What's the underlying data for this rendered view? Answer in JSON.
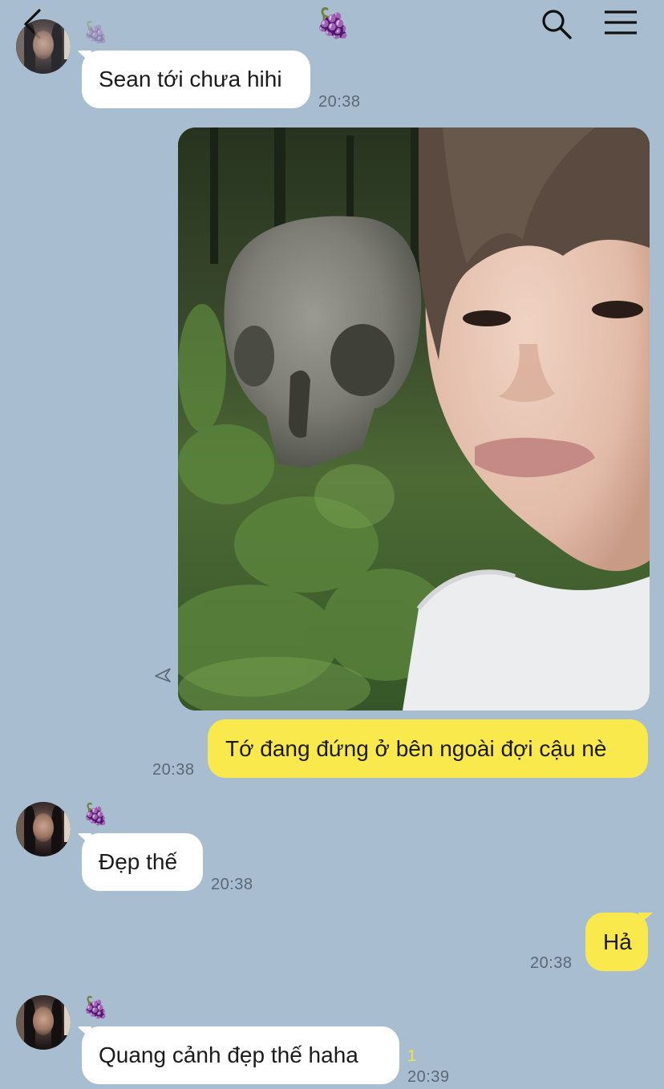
{
  "header": {
    "back_icon": "chevron-left-icon",
    "title_emoji": "🍇",
    "search_icon": "search-icon",
    "menu_icon": "hamburger-menu-icon"
  },
  "messages": [
    {
      "id": "m1",
      "direction": "in",
      "sender_emoji": "🍇",
      "text": "Sean tới chưa hihi",
      "time": "20:38"
    },
    {
      "id": "m2",
      "direction": "out",
      "type": "photo",
      "photo_alt": "selfie next to a large stone skull in a forest",
      "share_icon": "share-arrow-icon"
    },
    {
      "id": "m3",
      "direction": "out",
      "text": "Tớ đang đứng ở bên ngoài đợi cậu nè",
      "time": "20:38"
    },
    {
      "id": "m4",
      "direction": "in",
      "sender_emoji": "🍇",
      "text": "Đẹp thế",
      "time": "20:38"
    },
    {
      "id": "m5",
      "direction": "out",
      "text": "Hả",
      "time": "20:38"
    },
    {
      "id": "m6",
      "direction": "in",
      "sender_emoji": "🍇",
      "text": "Quang cảnh đẹp thế haha",
      "time": "20:39",
      "unread_count": "1"
    }
  ],
  "colors": {
    "background": "#a9bdd1",
    "incoming_bubble": "#ffffff",
    "outgoing_bubble": "#fae94d",
    "unread": "#f6e33a"
  }
}
